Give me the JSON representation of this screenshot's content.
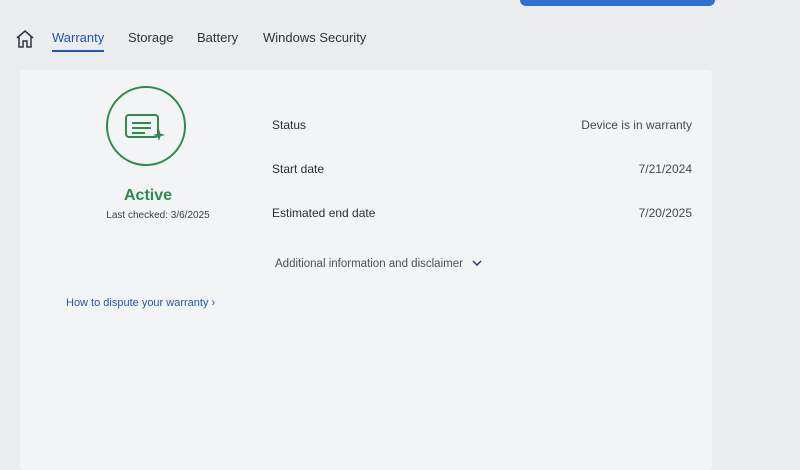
{
  "nav": {
    "tabs": [
      {
        "label": "Warranty",
        "active": true
      },
      {
        "label": "Storage",
        "active": false
      },
      {
        "label": "Battery",
        "active": false
      },
      {
        "label": "Windows Security",
        "active": false
      }
    ]
  },
  "warranty": {
    "status_badge": "Active",
    "last_checked": "Last checked: 3/6/2025",
    "dispute_link": "How to dispute your warranty ›",
    "details": [
      {
        "label": "Status",
        "value": "Device is in warranty"
      },
      {
        "label": "Start date",
        "value": "7/21/2024"
      },
      {
        "label": "Estimated end date",
        "value": "7/20/2025"
      }
    ],
    "additional_info": "Additional information and disclaimer"
  },
  "colors": {
    "accent": "#1f55b8",
    "success": "#2f8a4c",
    "top_bar": "#2f6fd0"
  }
}
